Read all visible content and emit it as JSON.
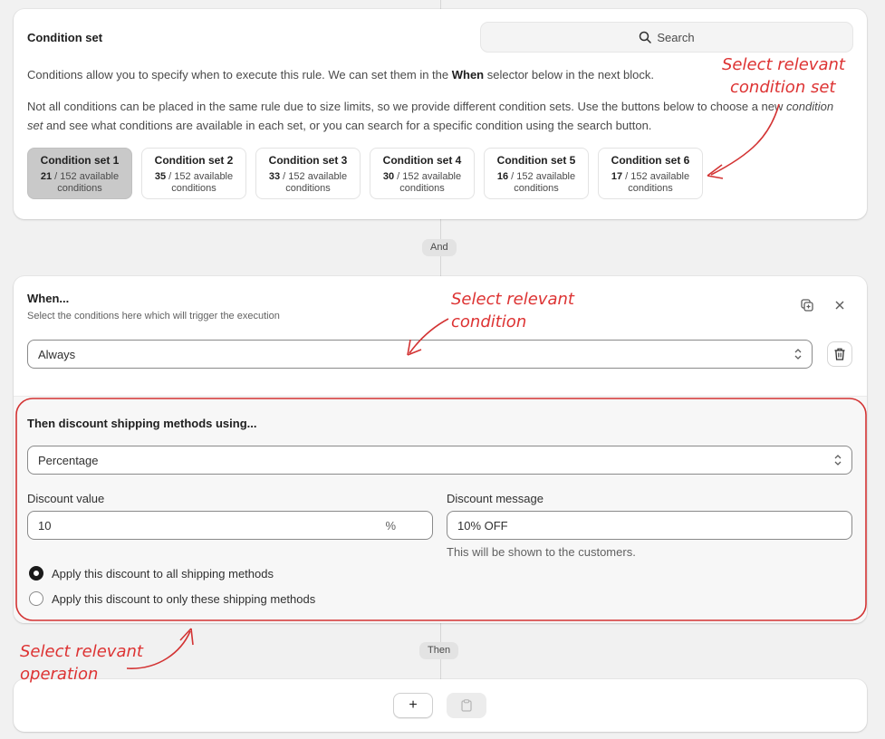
{
  "condition_set": {
    "title": "Condition set",
    "search_label": "Search",
    "desc1_pre": "Conditions allow you to specify when to execute this rule. We can set them in the ",
    "desc1_bold": "When",
    "desc1_post": " selector below in the next block.",
    "desc2_pre": "Not all conditions can be placed in the same rule due to size limits, so we provide different condition sets. Use the buttons below to choose a new ",
    "desc2_italic": "condition set",
    "desc2_post": " and see what conditions are available in each set, or you can search for a specific condition using the search button.",
    "sets": [
      {
        "name": "Condition set 1",
        "count": "21",
        "total": " / 152 available",
        "suffix": "conditions",
        "selected": true
      },
      {
        "name": "Condition set 2",
        "count": "35",
        "total": " / 152 available",
        "suffix": "conditions",
        "selected": false
      },
      {
        "name": "Condition set 3",
        "count": "33",
        "total": " / 152 available",
        "suffix": "conditions",
        "selected": false
      },
      {
        "name": "Condition set 4",
        "count": "30",
        "total": " / 152 available",
        "suffix": "conditions",
        "selected": false
      },
      {
        "name": "Condition set 5",
        "count": "16",
        "total": " / 152 available",
        "suffix": "conditions",
        "selected": false
      },
      {
        "name": "Condition set 6",
        "count": "17",
        "total": " / 152 available",
        "suffix": "conditions",
        "selected": false
      }
    ]
  },
  "connector_and": "And",
  "connector_then": "Then",
  "when": {
    "title": "When...",
    "subtitle": "Select the conditions here which will trigger the execution",
    "selected": "Always"
  },
  "then": {
    "title": "Then discount shipping methods using...",
    "method": "Percentage",
    "discount_value_label": "Discount value",
    "discount_value": "10",
    "discount_unit": "%",
    "discount_message_label": "Discount message",
    "discount_message": "10% OFF",
    "message_help": "This will be shown to the customers.",
    "radio_all": "Apply this discount to all shipping methods",
    "radio_only": "Apply this discount to only these shipping methods"
  },
  "add_label": "+",
  "annotations": {
    "condition_set_1": "Select relevant",
    "condition_set_2": "condition set",
    "condition_1": "Select relevant",
    "condition_2": "condition",
    "operation_1": "Select relevant",
    "operation_2": "operation"
  },
  "colors": {
    "annotation": "#d33333",
    "selected_set": "#c9c9c9"
  }
}
